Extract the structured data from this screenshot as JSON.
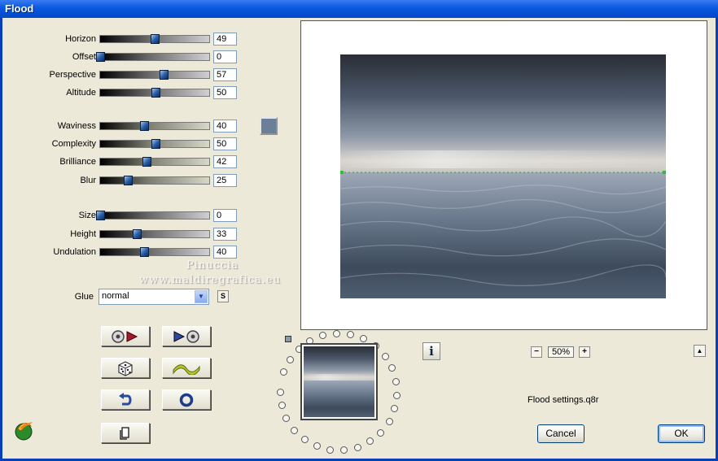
{
  "window": {
    "title": "Flood"
  },
  "sliders": [
    {
      "label": "Horizon",
      "value": "49",
      "level": 49,
      "track": "gray"
    },
    {
      "label": "Offset",
      "value": "0",
      "level": 0,
      "track": "gray"
    },
    {
      "label": "Perspective",
      "value": "57",
      "level": 57,
      "track": "gray"
    },
    {
      "label": "Altitude",
      "value": "50",
      "level": 50,
      "track": "gray"
    },
    {
      "label": "Waviness",
      "value": "40",
      "level": 40,
      "track": "olive"
    },
    {
      "label": "Complexity",
      "value": "50",
      "level": 50,
      "track": "olive"
    },
    {
      "label": "Brilliance",
      "value": "42",
      "level": 42,
      "track": "olive"
    },
    {
      "label": "Blur",
      "value": "25",
      "level": 25,
      "track": "olive"
    },
    {
      "label": "Size",
      "value": "0",
      "level": 0,
      "track": "gray"
    },
    {
      "label": "Height",
      "value": "33",
      "level": 33,
      "track": "gray"
    },
    {
      "label": "Undulation",
      "value": "40",
      "level": 40,
      "track": "gray"
    }
  ],
  "colors": {
    "swatch": "#6c7f98",
    "accent": "#0858e0"
  },
  "glue": {
    "label": "Glue",
    "selected": "normal",
    "side_button": "S"
  },
  "watermark": {
    "line1": "Pinuccia",
    "line2": "www.maldiregrafica.eu"
  },
  "toolbar_icons": [
    "save-preset-icon",
    "load-preset-icon",
    "dice-random-icon",
    "wave-icon",
    "undo-icon",
    "reset-circle-icon",
    "copy-page-icon"
  ],
  "preview": {
    "zoom": "50%",
    "zoom_minus": "−",
    "zoom_plus": "+",
    "info": "i",
    "caret": "▲"
  },
  "settings_file": "Flood settings.q8r",
  "buttons": {
    "cancel": "Cancel",
    "ok": "OK"
  }
}
